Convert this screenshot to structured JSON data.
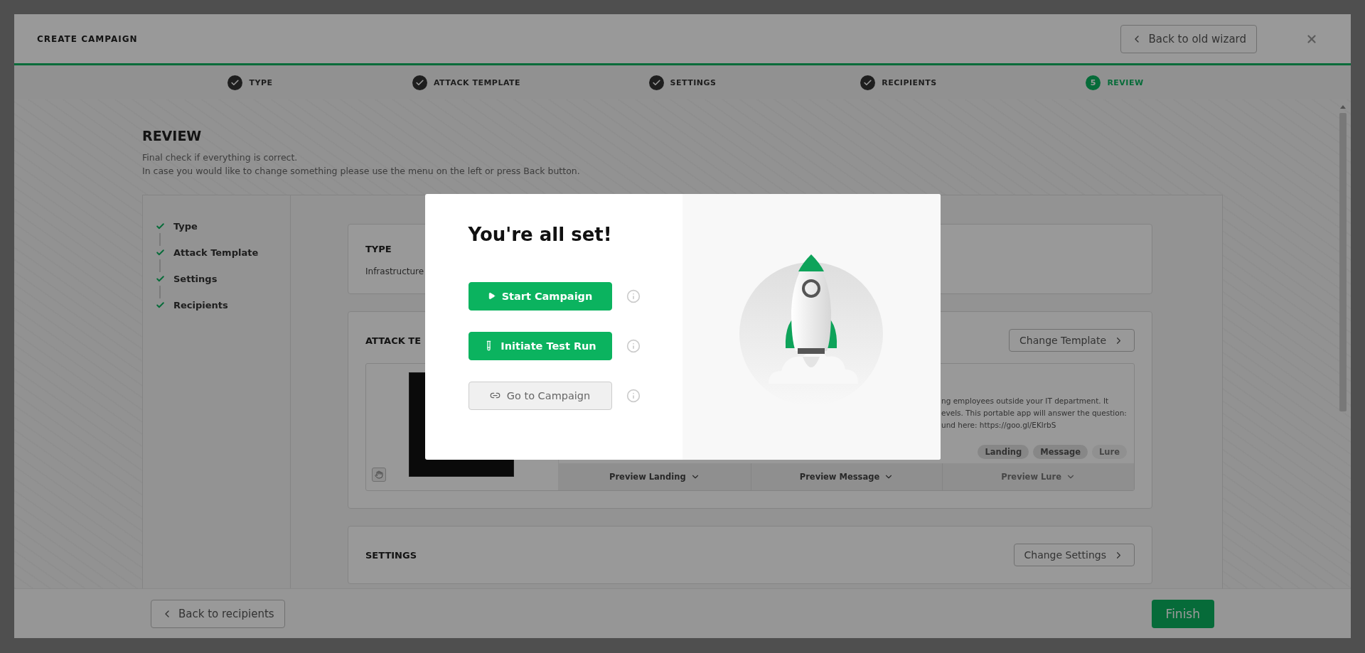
{
  "dialog": {
    "title": "CREATE CAMPAIGN",
    "back_button": "Back to old wizard"
  },
  "steps": [
    {
      "label": "TYPE",
      "done": true,
      "selected": false
    },
    {
      "label": "ATTACK TEMPLATE",
      "done": true,
      "selected": false
    },
    {
      "label": "SETTINGS",
      "done": true,
      "selected": false
    },
    {
      "label": "RECIPIENTS",
      "done": true,
      "selected": false
    },
    {
      "label": "REVIEW",
      "number": "5",
      "done": false,
      "selected": true
    }
  ],
  "review": {
    "title": "REVIEW",
    "subtitle_lines": [
      "Final check if everything is correct.",
      "In case you would like to change something please use the menu on the left or press Back button."
    ]
  },
  "nav": [
    {
      "label": "Type",
      "checked": true
    },
    {
      "label": "Attack Template",
      "checked": true
    },
    {
      "label": "Settings",
      "checked": true
    },
    {
      "label": "Recipients",
      "checked": true
    }
  ],
  "type_card": {
    "title": "TYPE",
    "value": "Infrastructure"
  },
  "template_card": {
    "title": "ATTACK TE",
    "button": "Change Template",
    "description_lines": [
      "ng employees outside your IT department. It",
      "evels. This portable app will answer the question:",
      "und here: https://goo.gl/EKlrbS"
    ],
    "tags": [
      {
        "label": "Landing",
        "disabled": false
      },
      {
        "label": "Message",
        "disabled": false
      },
      {
        "label": "Lure",
        "disabled": true
      }
    ],
    "previews": [
      {
        "label": "Preview Landing",
        "disabled": false
      },
      {
        "label": "Preview Message",
        "disabled": false
      },
      {
        "label": "Preview Lure",
        "disabled": true
      }
    ]
  },
  "settings_card": {
    "title": "SETTINGS",
    "button": "Change Settings"
  },
  "footer": {
    "back": "Back to recipients",
    "finish": "Finish"
  },
  "modal": {
    "title": "You're all set!",
    "actions": [
      {
        "label": "Start Campaign",
        "kind": "start",
        "primary": true
      },
      {
        "label": "Initiate Test Run",
        "kind": "test",
        "primary": true
      },
      {
        "label": "Go to Campaign",
        "kind": "link",
        "primary": false
      }
    ]
  }
}
